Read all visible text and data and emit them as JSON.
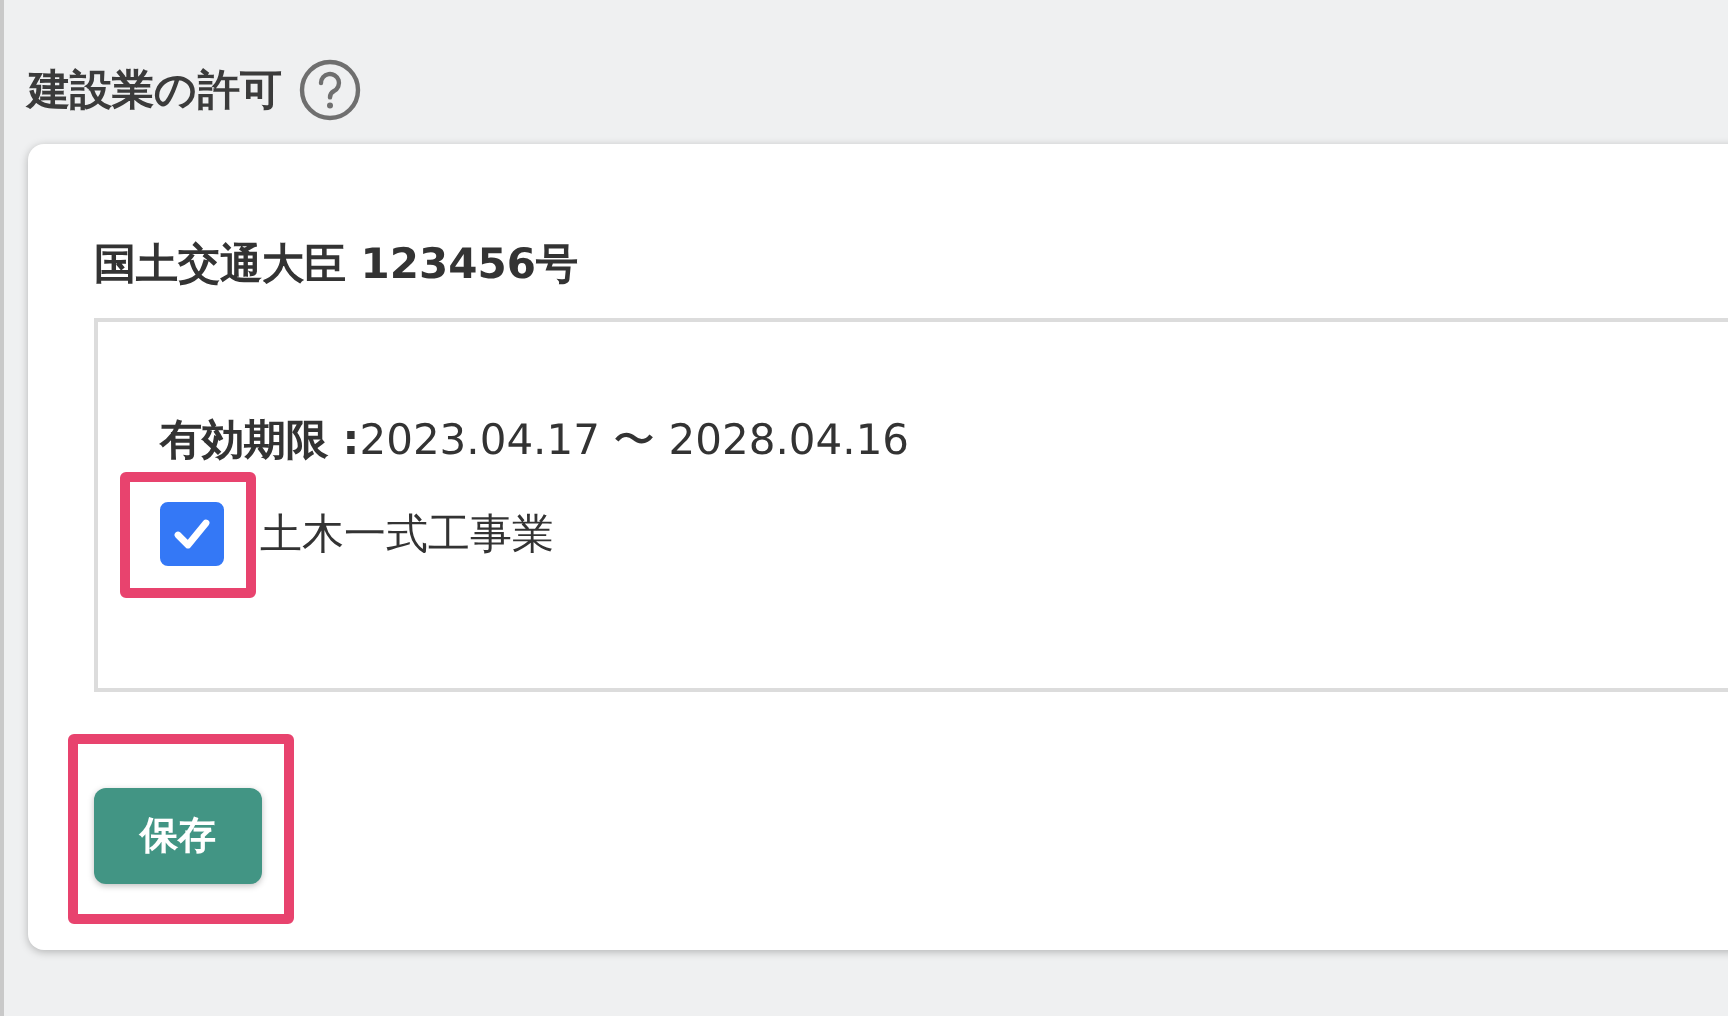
{
  "section": {
    "title": "建設業の許可"
  },
  "license": {
    "title": "国土交通大臣 123456号",
    "validity": "**有効期限 :**2023.04.17 〜 2028.04.16",
    "works": [
      {
        "label": "土木一式工事業",
        "checked": true,
        "highlighted": true
      }
    ]
  },
  "save_button": {
    "label": "保存",
    "highlighted": true
  }
}
